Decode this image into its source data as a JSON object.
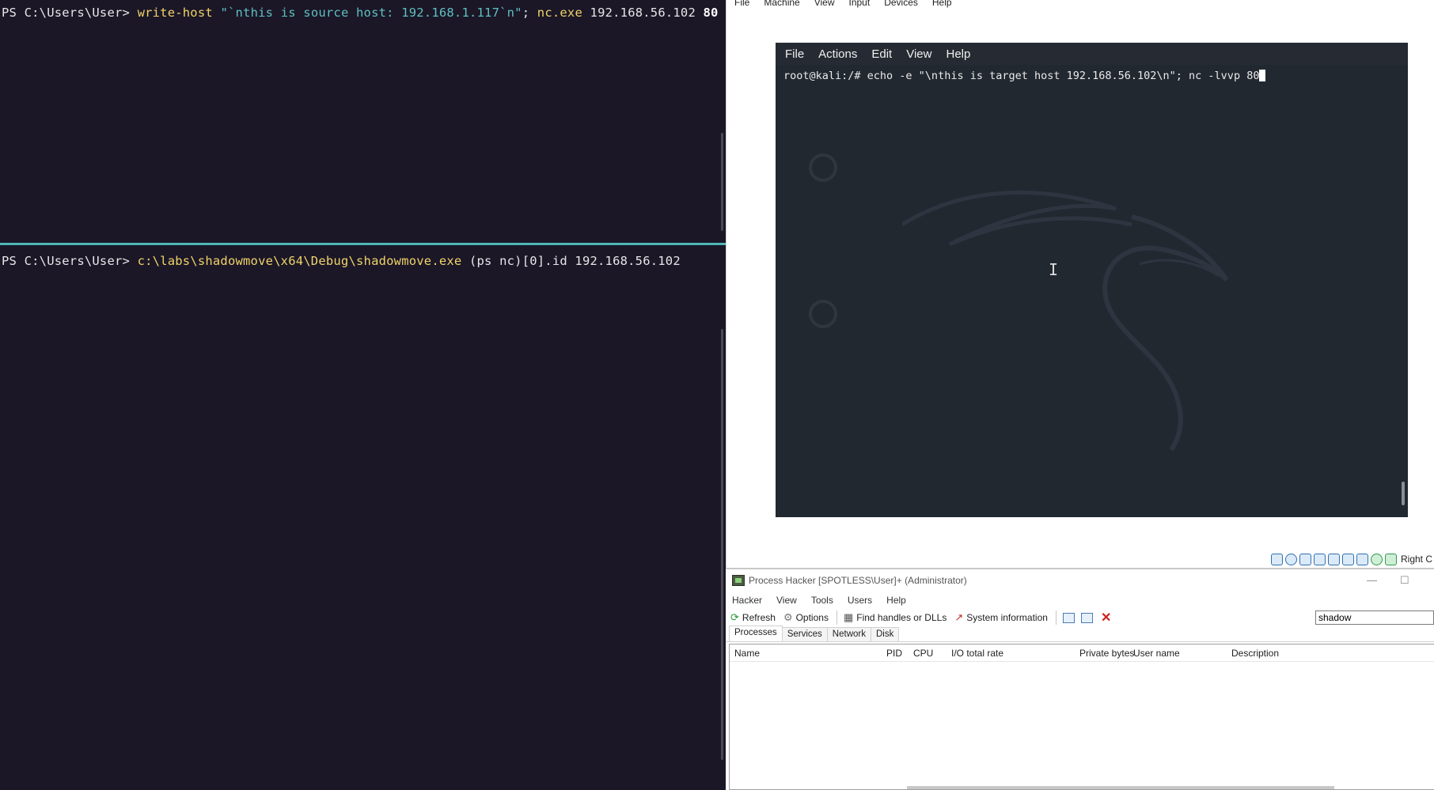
{
  "terminal": {
    "top_pane": {
      "prompt": "PS C:\\Users\\User> ",
      "cmd1": "write-host",
      "str1": " \"`nthis is source host: 192.168.1.117`n\"",
      "sep": ";",
      "cmd2": " nc.exe",
      "arg_host": " 192.168.56.102",
      "arg_port": " 80"
    },
    "bottom_pane": {
      "prompt": "PS C:\\Users\\User> ",
      "cmd": "c:\\labs\\shadowmove\\x64\\Debug\\shadowmove.exe",
      "args": " (ps nc)[0].id 192.168.56.102"
    }
  },
  "vbox": {
    "menu": [
      "File",
      "Machine",
      "View",
      "Input",
      "Devices",
      "Help"
    ],
    "status_right_label": "Right C",
    "kali": {
      "menu": [
        "File",
        "Actions",
        "Edit",
        "View",
        "Help"
      ],
      "command_line": "root@kali:/# echo -e \"\\nthis is target host 192.168.56.102\\n\"; nc -lvvp 80",
      "ibeam": "I"
    }
  },
  "process_hacker": {
    "title": "Process Hacker [SPOTLESS\\User]+ (Administrator)",
    "minimize": "—",
    "maximize": "☐",
    "menu": [
      "Hacker",
      "View",
      "Tools",
      "Users",
      "Help"
    ],
    "toolbar": {
      "refresh": "Refresh",
      "options": "Options",
      "find_handles": "Find handles or DLLs",
      "system_info": "System information"
    },
    "search_value": "shadow",
    "tabs": [
      "Processes",
      "Services",
      "Network",
      "Disk"
    ],
    "columns": [
      "Name",
      "PID",
      "CPU",
      "I/O total rate",
      "Private bytes",
      "User name",
      "Description"
    ]
  }
}
